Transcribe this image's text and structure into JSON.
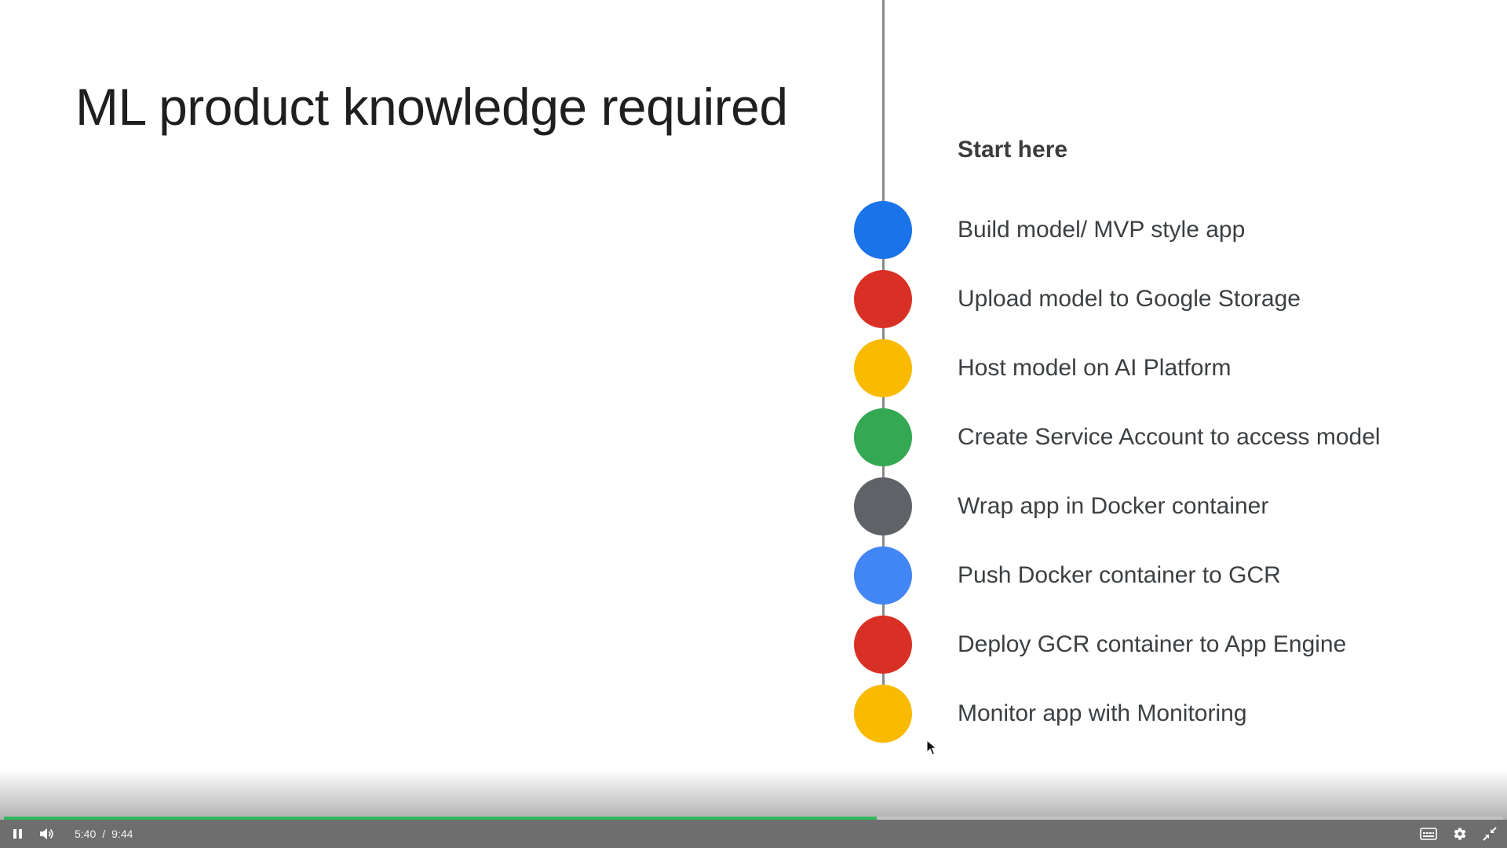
{
  "slide": {
    "title": "ML product knowledge required",
    "start_label": "Start here",
    "steps": [
      {
        "label": "Build model/ MVP style app",
        "color": "#1a73e8"
      },
      {
        "label": "Upload model to Google Storage",
        "color": "#d93025"
      },
      {
        "label": "Host model on AI Platform",
        "color": "#f9ba00"
      },
      {
        "label": "Create Service Account to access model",
        "color": "#34a853"
      },
      {
        "label": "Wrap app in Docker container",
        "color": "#5f6368"
      },
      {
        "label": "Push Docker container to GCR",
        "color": "#4285f4"
      },
      {
        "label": "Deploy GCR container to App Engine",
        "color": "#d93025"
      },
      {
        "label": "Monitor app with Monitoring",
        "color": "#f9ba00"
      }
    ]
  },
  "player": {
    "current_time": "5:40",
    "separator": "/",
    "duration": "9:44",
    "progress_fraction": 0.582,
    "progress_color": "#2fb85a",
    "icons": {
      "play_pause": "pause-icon",
      "volume": "volume-icon",
      "captions": "captions-icon",
      "settings": "gear-icon",
      "fullscreen": "exit-fullscreen-icon"
    }
  }
}
